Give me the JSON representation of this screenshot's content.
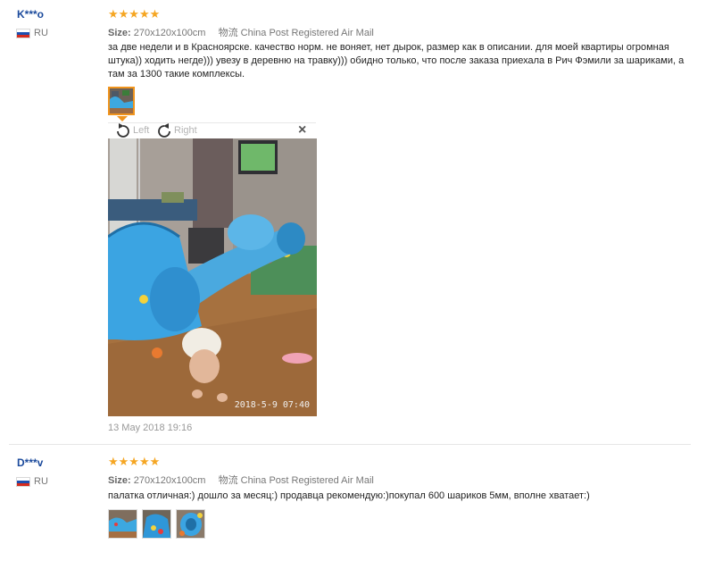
{
  "reviews": [
    {
      "user": "K***o",
      "country": "RU",
      "stars": "★★★★★",
      "rating": 5,
      "size_label": "Size:",
      "size_value": "270x120x100cm",
      "shipping": "物流 China Post Registered Air Mail",
      "text": "за две недели и в Красноярске. качество норм. не воняет, нет дырок, размер как в описании. для моей квартиры огромная штука)) ходить негде))) увезу в деревню на травку))) обидно только, что после заказа приехала в Рич Фэмили за шариками, а там за 1300 такие комплексы.",
      "date": "13 May 2018 19:16"
    },
    {
      "user": "D***v",
      "country": "RU",
      "stars": "★★★★★",
      "rating": 5,
      "size_label": "Size:",
      "size_value": "270x120x100cm",
      "shipping": "物流 China Post Registered Air Mail",
      "text": "палатка отличная:) дошло за месяц:) продавца рекомендую:)покупал 600 шариков 5мм, вполне хватает:)"
    }
  ],
  "viewer": {
    "rotate_left": "Left",
    "rotate_right": "Right",
    "close": "×",
    "photo_timestamp": "2018-5-9  07:40"
  },
  "icons": {
    "rotate_left": "rotate-left-icon",
    "rotate_right": "rotate-right-icon",
    "close": "close-icon"
  },
  "colors": {
    "username": "#1b4a9c",
    "star": "#f5a623",
    "accent_selected": "#f0941d"
  }
}
